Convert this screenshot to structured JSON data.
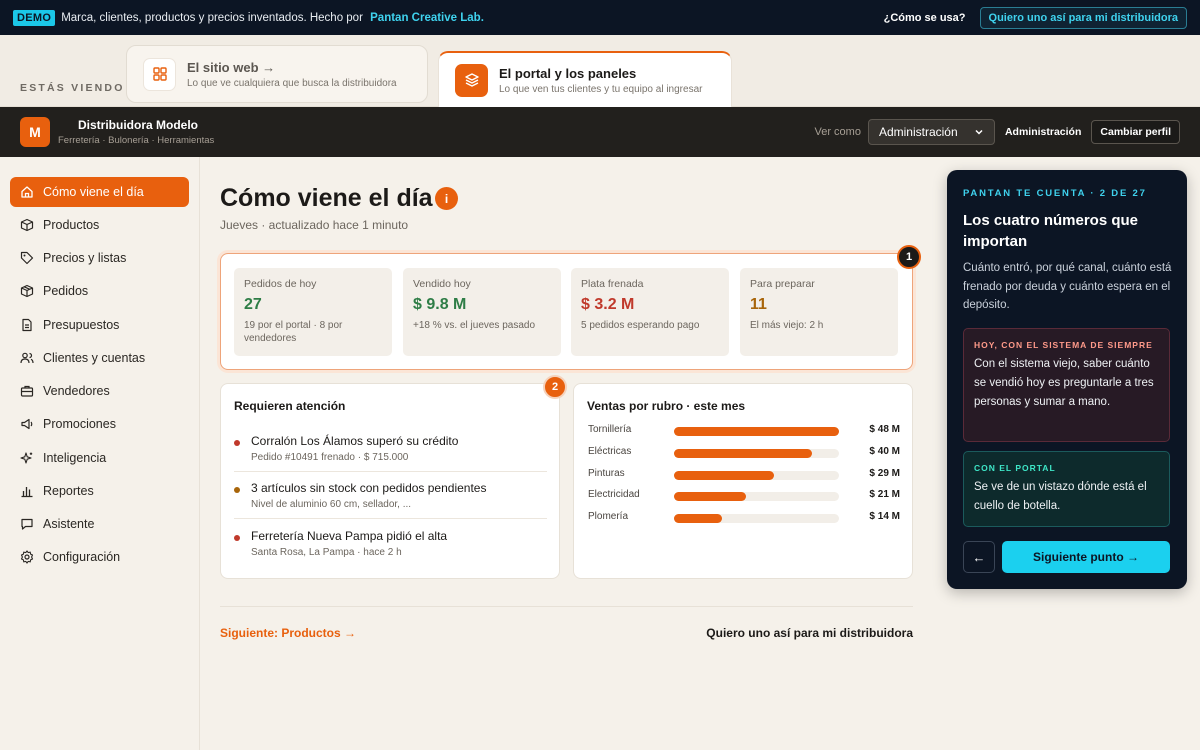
{
  "demo_bar": {
    "badge": "DEMO",
    "text": "Marca, clientes, productos y precios inventados. Hecho por",
    "credit": "Pantan Creative Lab.",
    "howto": "¿Cómo se usa?",
    "cta": "Quiero uno así para mi distribuidora"
  },
  "switcher": {
    "viewing_label": "ESTÁS VIENDO",
    "tabs": [
      {
        "title": "El sitio web →",
        "subtitle": "Lo que ve cualquiera que busca la distribuidora",
        "icon": "grid-icon",
        "active": false
      },
      {
        "title": "El portal y los paneles",
        "subtitle": "Lo que ven tus clientes y tu equipo al ingresar",
        "icon": "layers-icon",
        "active": true
      }
    ]
  },
  "app_header": {
    "logo_letter": "M",
    "name": "Distribuidora Modelo",
    "tagline": "Ferretería · Bulonería · Herramientas",
    "view_as_label": "Ver como",
    "role_selected": "Administración",
    "current_role": "Administración",
    "change_profile": "Cambiar perfil"
  },
  "sidebar": {
    "items": [
      {
        "label": "Cómo viene el día",
        "icon": "home-icon",
        "active": true
      },
      {
        "label": "Productos",
        "icon": "box-icon"
      },
      {
        "label": "Precios y listas",
        "icon": "tag-icon"
      },
      {
        "label": "Pedidos",
        "icon": "package-icon"
      },
      {
        "label": "Presupuestos",
        "icon": "document-icon"
      },
      {
        "label": "Clientes y cuentas",
        "icon": "users-icon"
      },
      {
        "label": "Vendedores",
        "icon": "briefcase-icon"
      },
      {
        "label": "Promociones",
        "icon": "megaphone-icon"
      },
      {
        "label": "Inteligencia",
        "icon": "sparkles-icon"
      },
      {
        "label": "Reportes",
        "icon": "bar-chart-icon"
      },
      {
        "label": "Asistente",
        "icon": "chat-icon"
      },
      {
        "label": "Configuración",
        "icon": "gear-icon"
      }
    ]
  },
  "main": {
    "title": "Cómo viene el día",
    "info_badge": "i",
    "subtitle": "Jueves · actualizado hace 1 minuto",
    "step1": "1",
    "step2": "2",
    "kpis": [
      {
        "label": "Pedidos de hoy",
        "value": "27",
        "sub": "19 por el portal · 8 por vendedores",
        "color": "#2e7d46"
      },
      {
        "label": "Vendido hoy",
        "value": "$ 9.8 M",
        "sub": "+18 % vs. el jueves pasado",
        "color": "#2e7d46"
      },
      {
        "label": "Plata frenada",
        "value": "$ 3.2 M",
        "sub": "5 pedidos esperando pago",
        "color": "#c0392b"
      },
      {
        "label": "Para preparar",
        "value": "11",
        "sub": "El más viejo: 2 h",
        "color": "#a8650a"
      }
    ],
    "attention": {
      "title": "Requieren atención",
      "items": [
        {
          "title": "Corralón Los Álamos superó su crédito",
          "sub": "Pedido #10491 frenado · $ 715.000",
          "dot_color": "#c0392b"
        },
        {
          "title": "3 artículos sin stock con pedidos pendientes",
          "sub": "Nivel de aluminio 60 cm, sellador, ...",
          "dot_color": "#a8650a"
        },
        {
          "title": "Ferretería Nueva Pampa pidió el alta",
          "sub": "Santa Rosa, La Pampa · hace 2 h",
          "dot_color": "#c0392b"
        }
      ]
    },
    "sales_title": "Ventas por rubro · este mes",
    "footer": {
      "next": "Siguiente: Productos →",
      "want": "Quiero uno así para mi distribuidora"
    }
  },
  "chart_data": {
    "type": "bar",
    "title": "Ventas por rubro · este mes",
    "categories": [
      "Tornillería",
      "Eléctricas",
      "Pinturas",
      "Electricidad",
      "Plomería"
    ],
    "values": [
      48,
      40,
      29,
      21,
      14
    ],
    "value_labels": [
      "$ 48 M",
      "$ 40 M",
      "$ 29 M",
      "$ 21 M",
      "$ 14 M"
    ],
    "max": 48,
    "color": "#e8600e"
  },
  "tour": {
    "eyebrow": "PANTAN TE CUENTA · 2 DE 27",
    "title": "Los cuatro números que importan",
    "desc": "Cuánto entró, por qué canal, cuánto está frenado por deuda y cuánto espera en el depósito.",
    "old_heading": "HOY, CON EL SISTEMA DE SIEMPRE",
    "old_body": "Con el sistema viejo, saber cuánto se vendió hoy es preguntarle a tres personas y sumar a mano.",
    "new_heading": "CON EL PORTAL",
    "new_body": "Se ve de un vistazo dónde está el cuello de botella.",
    "prev": "←",
    "next": "Siguiente punto →"
  }
}
